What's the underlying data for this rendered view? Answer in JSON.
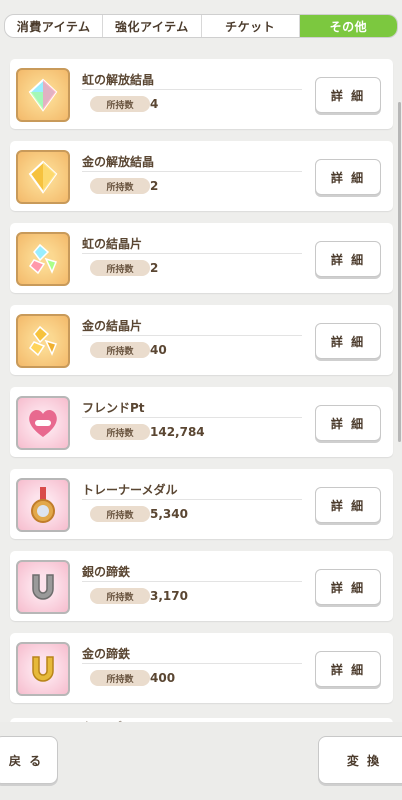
{
  "tabs": [
    {
      "label": "消費アイテム",
      "active": false
    },
    {
      "label": "強化アイテム",
      "active": false
    },
    {
      "label": "チケット",
      "active": false
    },
    {
      "label": "その他",
      "active": true
    }
  ],
  "count_label": "所持数",
  "detail_label": "詳 細",
  "items": [
    {
      "name": "虹の解放結晶",
      "count": "4",
      "icon": "rainbow-crystal-icon",
      "theme": "gold"
    },
    {
      "name": "金の解放結晶",
      "count": "2",
      "icon": "gold-crystal-icon",
      "theme": "gold"
    },
    {
      "name": "虹の結晶片",
      "count": "2",
      "icon": "rainbow-shard-icon",
      "theme": "gold"
    },
    {
      "name": "金の結晶片",
      "count": "40",
      "icon": "gold-shard-icon",
      "theme": "gold"
    },
    {
      "name": "フレンドPt",
      "count": "142,784",
      "icon": "friend-handshake-icon",
      "theme": "pink"
    },
    {
      "name": "トレーナーメダル",
      "count": "5,340",
      "icon": "trainer-medal-icon",
      "theme": "pink"
    },
    {
      "name": "銀の蹄鉄",
      "count": "3,170",
      "icon": "silver-horseshoe-icon",
      "theme": "pink"
    },
    {
      "name": "金の蹄鉄",
      "count": "400",
      "icon": "gold-horseshoe-icon",
      "theme": "pink"
    }
  ],
  "partial_item_name": "クラ…ブ",
  "footer": {
    "back_label": "戻 る",
    "exchange_label": "変 換"
  }
}
